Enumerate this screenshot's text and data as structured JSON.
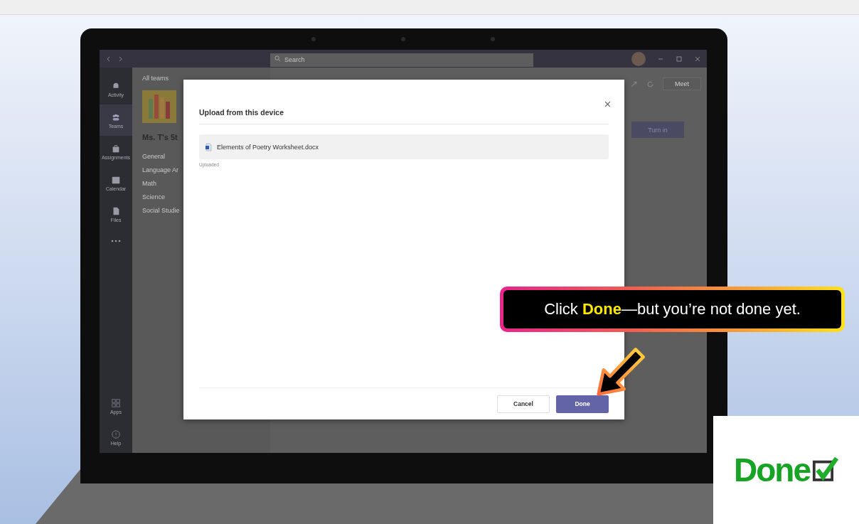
{
  "app": {
    "search": {
      "placeholder": "Search"
    },
    "rail": [
      {
        "label": "Activity",
        "selected": false
      },
      {
        "label": "Teams",
        "selected": true
      },
      {
        "label": "Assignments",
        "selected": false
      },
      {
        "label": "Calendar",
        "selected": false
      },
      {
        "label": "Files",
        "selected": false
      }
    ],
    "rail_bottom": [
      {
        "label": "Apps"
      },
      {
        "label": "Help"
      }
    ],
    "back_link": "All teams",
    "team_name": "Ms. T's 5t",
    "channels": [
      "General",
      "Language Ar",
      "Math",
      "Science",
      "Social Studie"
    ],
    "meet_button": "Meet",
    "turn_in_button": "Turn in"
  },
  "dialog": {
    "title": "Upload from this device",
    "file": {
      "name": "Elements of Poetry Worksheet.docx",
      "status": "Uploaded"
    },
    "buttons": [
      {
        "label": "Cancel",
        "primary": false
      },
      {
        "label": "Done",
        "primary": true
      }
    ]
  },
  "callout": "Click **Done**—but you’re not done yet.",
  "sticker_text": "Done"
}
